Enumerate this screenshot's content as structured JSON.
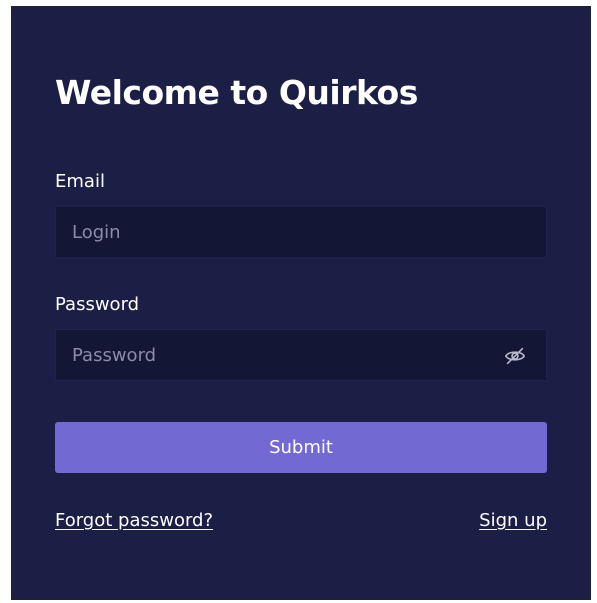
{
  "header": {
    "title": "Welcome to Quirkos"
  },
  "form": {
    "email_label": "Email",
    "email_placeholder": "Login",
    "email_value": "",
    "password_label": "Password",
    "password_placeholder": "Password",
    "password_value": "",
    "password_toggle_icon": "eye-slash-icon",
    "submit_label": "Submit"
  },
  "links": {
    "forgot_password": "Forgot password?",
    "sign_up": "Sign up"
  },
  "colors": {
    "panel_background": "#1b1e45",
    "input_background": "#141636",
    "accent": "#7369d3",
    "text": "#ffffff",
    "placeholder": "#8a8ca8"
  }
}
